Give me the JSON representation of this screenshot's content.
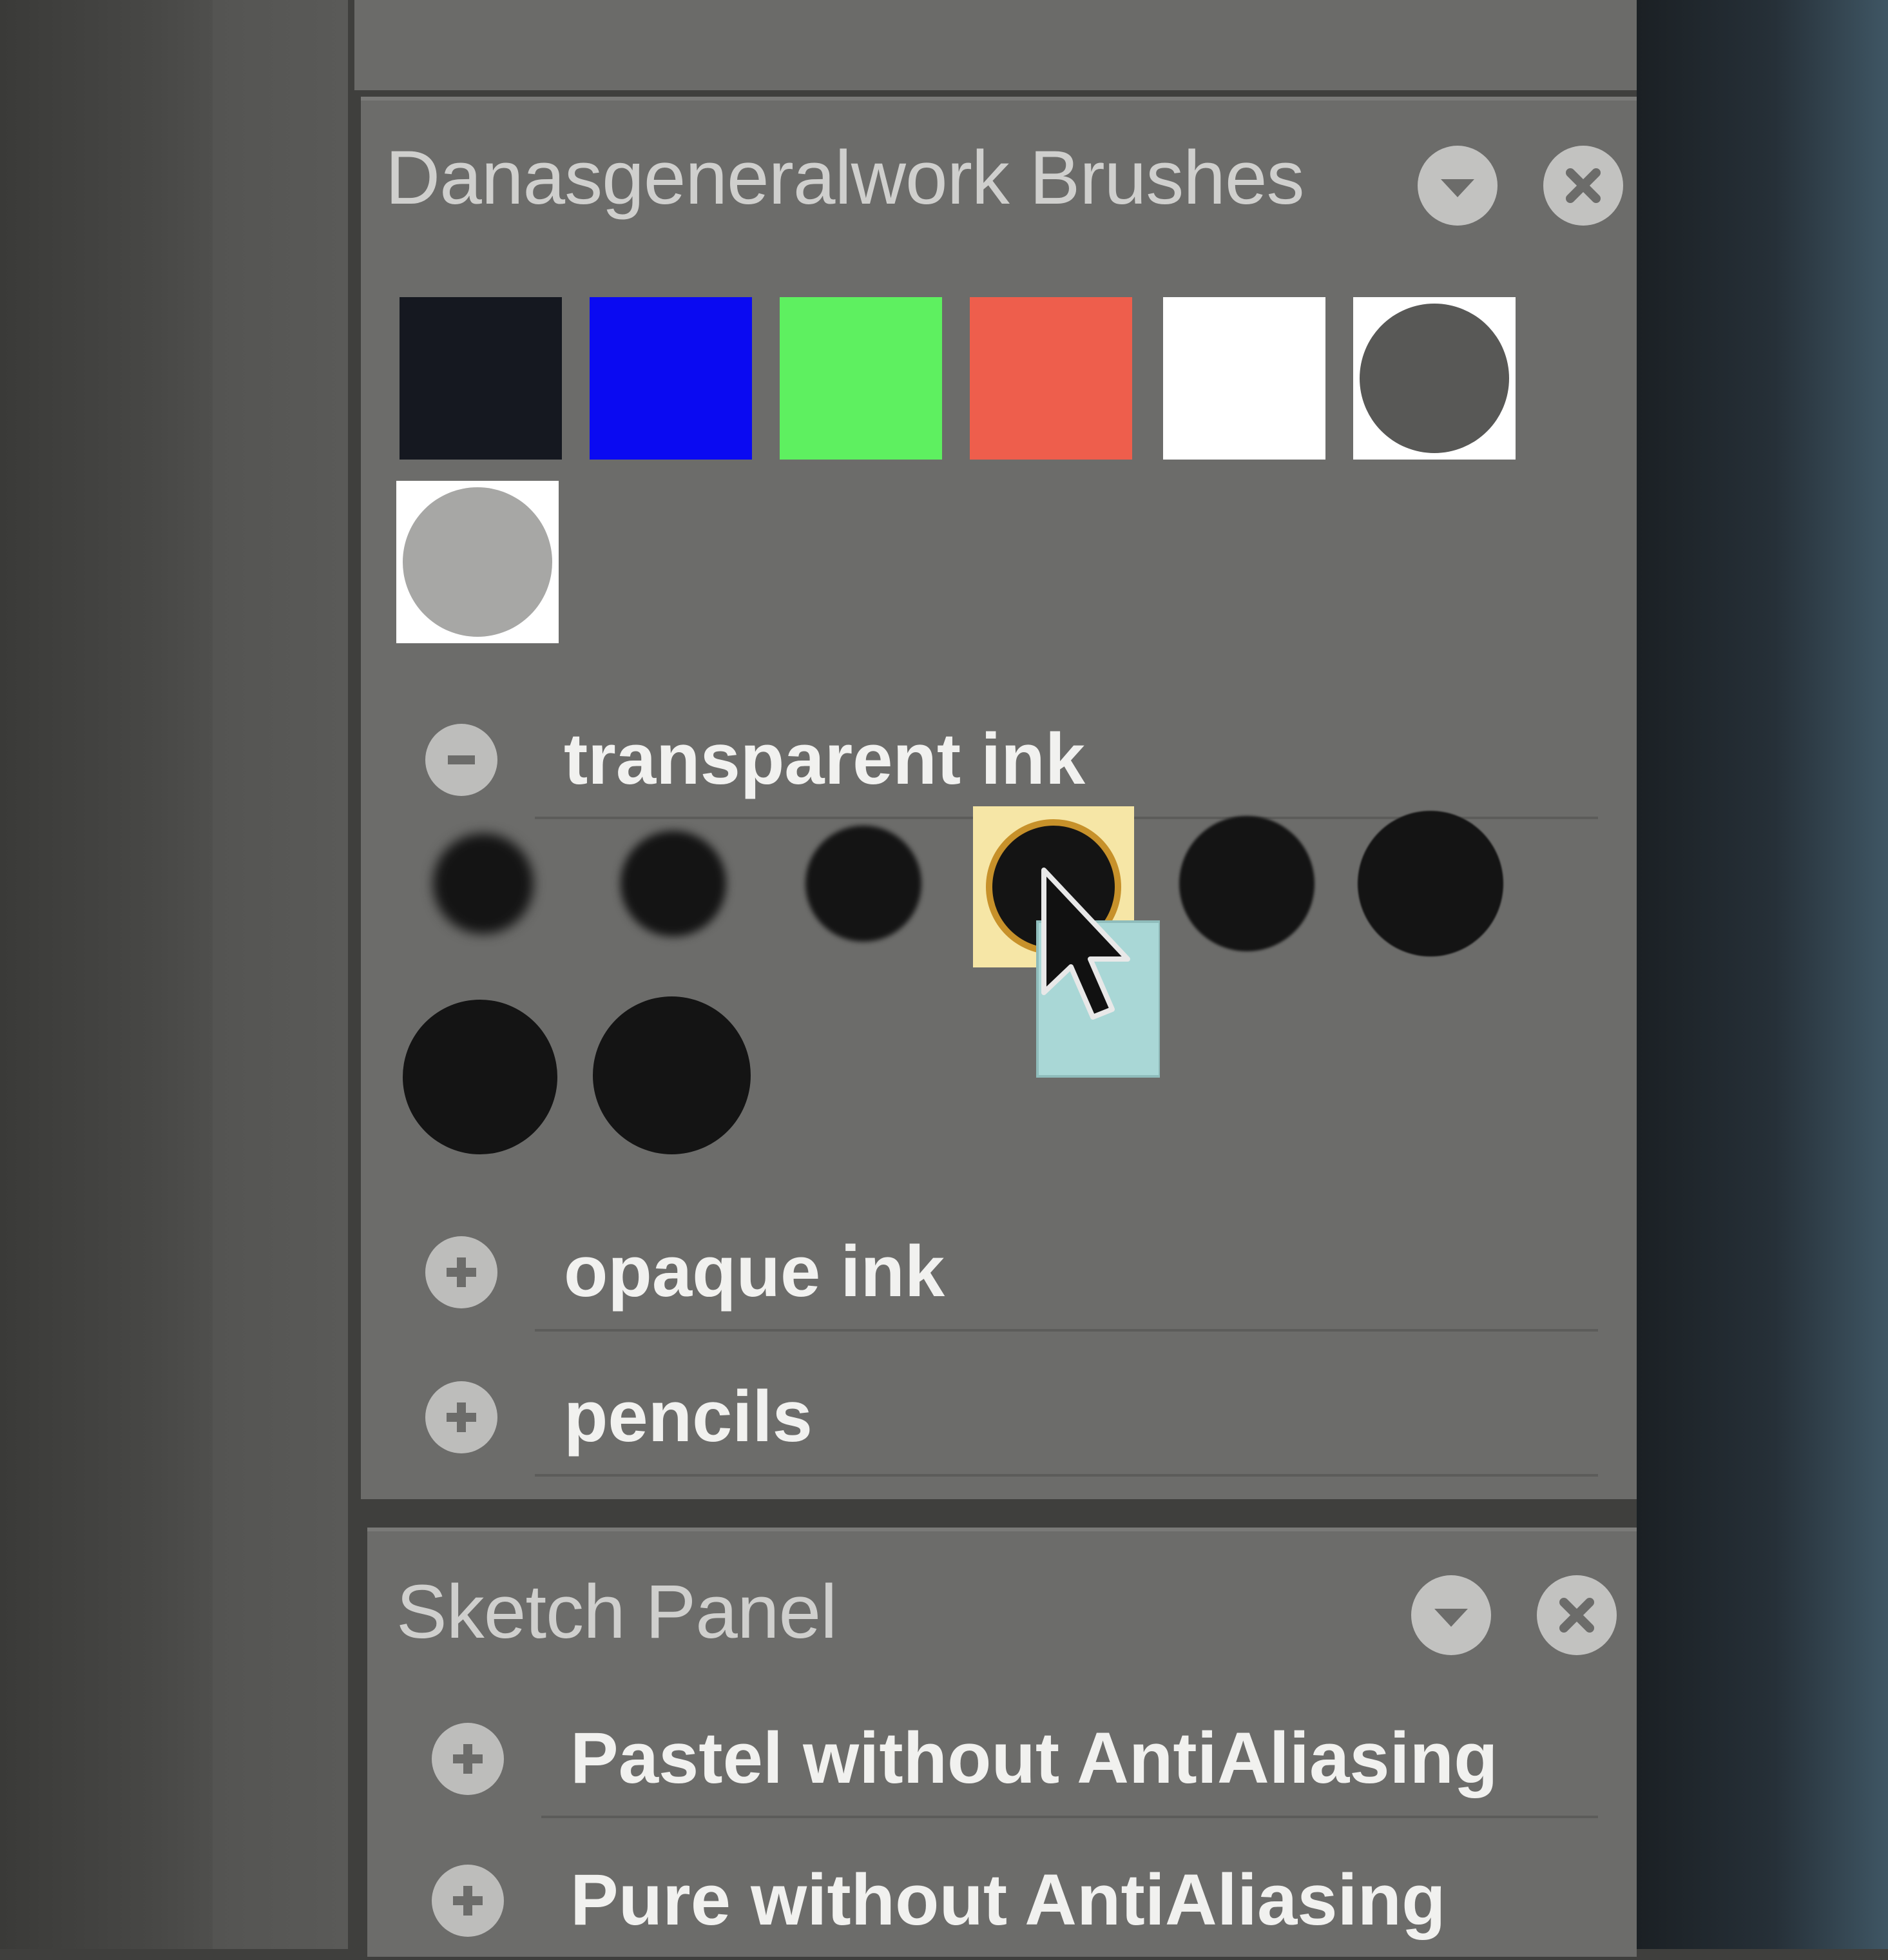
{
  "brushes_panel": {
    "title": "Danasgeneralwork Brushes",
    "collapse_icon": "chevron-down-circle",
    "close_icon": "close-circle",
    "color_swatches": [
      {
        "name": "black",
        "color": "#151820"
      },
      {
        "name": "blue",
        "color": "#0a0af2"
      },
      {
        "name": "green",
        "color": "#5ef060"
      },
      {
        "name": "red",
        "color": "#ee5e4c"
      },
      {
        "name": "white",
        "color": "#ffffff"
      },
      {
        "name": "transparent-dark",
        "color": "#585856"
      },
      {
        "name": "transparent-gray",
        "color": "#a7a7a5"
      }
    ],
    "groups": [
      {
        "label": "transparent ink",
        "icon": "minus-circle",
        "expanded": true
      },
      {
        "label": "opaque ink",
        "icon": "plus-circle",
        "expanded": false
      },
      {
        "label": "pencils",
        "icon": "plus-circle",
        "expanded": false
      }
    ],
    "transparent_ink_selected_index": 3,
    "selection_color": "#f6e6a6"
  },
  "sketch_panel": {
    "title": "Sketch Panel",
    "collapse_icon": "chevron-down-circle",
    "close_icon": "close-circle",
    "groups": [
      {
        "label": "Pastel without AntiAliasing",
        "icon": "plus-circle",
        "expanded": false
      },
      {
        "label": "Pure without AntiAliasing",
        "icon": "plus-circle",
        "expanded": false
      }
    ]
  },
  "cursor": {
    "icon": "arrow-cursor",
    "drag_preview_color": "#a9d7d6"
  }
}
